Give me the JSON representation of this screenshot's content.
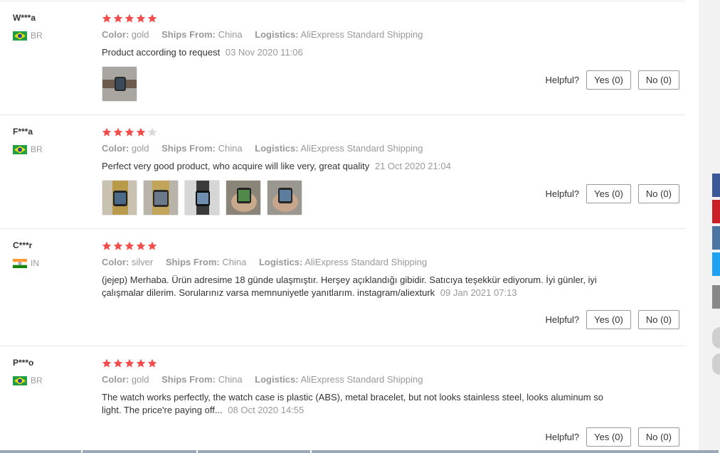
{
  "helpful_label": "Helpful?",
  "labels": {
    "color": "Color:",
    "ships": "Ships From:",
    "logistics": "Logistics:"
  },
  "reviews": [
    {
      "user": "W***a",
      "country": "BR",
      "rating": 5,
      "color": "gold",
      "ships_from": "China",
      "logistics": "AliExpress Standard Shipping",
      "text": "Product according to request",
      "date": "03 Nov 2020 11:06",
      "yes": "Yes (0)",
      "no": "No (0)",
      "photos": 1
    },
    {
      "user": "F***a",
      "country": "BR",
      "rating": 4,
      "color": "gold",
      "ships_from": "China",
      "logistics": "AliExpress Standard Shipping",
      "text": "Perfect very good product, who acquire will like very, great quality",
      "date": "21 Oct 2020 21:04",
      "yes": "Yes (0)",
      "no": "No (0)",
      "photos": 5
    },
    {
      "user": "C***r",
      "country": "IN",
      "rating": 5,
      "color": "silver",
      "ships_from": "China",
      "logistics": "AliExpress Standard Shipping",
      "text": "(jejep) Merhaba. Ürün adresime 18 günde ulaşmıştır. Herşey açıklandığı gibidir. Satıcıya teşekkür ediyorum. İyi günler, iyi çalışmalar dilerim. Sorularınız varsa memnuniyetle yanıtlarım. instagram/aliexturk",
      "date": "09 Jan 2021 07:13",
      "yes": "Yes (0)",
      "no": "No (0)",
      "photos": 0
    },
    {
      "user": "P***o",
      "country": "BR",
      "rating": 5,
      "color": "gold",
      "ships_from": "China",
      "logistics": "AliExpress Standard Shipping",
      "text": "The watch works perfectly, the watch case is plastic (ABS), metal bracelet, but not looks stainless steel, looks aluminum so light. The price're paying off...",
      "date": "08 Oct 2020 14:55",
      "yes": "Yes (0)",
      "no": "No (0)",
      "photos": 0
    }
  ],
  "colors": {
    "star": "#f44b4b",
    "star_empty": "#d8d8d8",
    "muted": "#999999"
  }
}
